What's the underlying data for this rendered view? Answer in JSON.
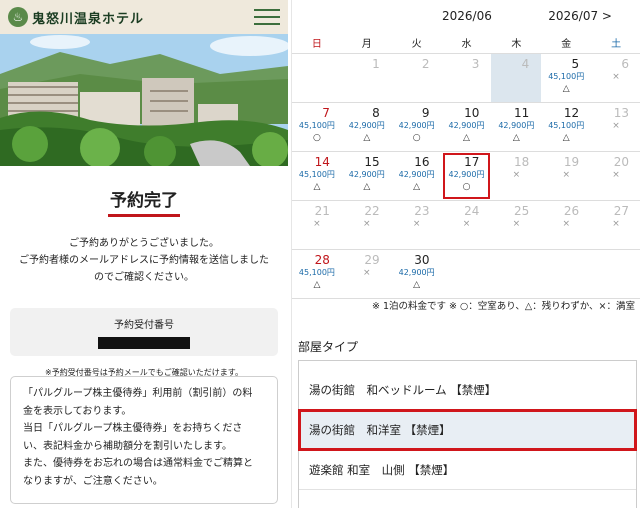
{
  "brand": {
    "name": "鬼怒川温泉ホテル"
  },
  "confirmation": {
    "title": "予約完了",
    "line1": "ご予約ありがとうございました。",
    "line2": "ご予約者様のメールアドレスに予約情報を送信しました",
    "line3": "のでご確認ください。",
    "receipt_label": "予約受付番号",
    "receipt_note": "※予約受付番号は予約メールでもご確認いただけます。"
  },
  "info": {
    "lines": [
      "「パルグループ株主優待券」利用前（割引前）の料",
      "金を表示しております。",
      "当日「パルグループ株主優待券」をお持ちくださ",
      "い、表記料金から補助額分を割引いたします。",
      "また、優待券をお忘れの場合は通常料金でご精算と",
      "なりますが、ご注意ください。"
    ]
  },
  "calendar": {
    "current_month": "2026/06",
    "next_month": "2026/07 >",
    "weekdays": [
      "日",
      "月",
      "火",
      "水",
      "木",
      "金",
      "土"
    ],
    "weeks": [
      [
        {
          "day": "",
          "price": "",
          "mark": "",
          "state": "empty"
        },
        {
          "day": "1",
          "price": "",
          "mark": "",
          "state": "past"
        },
        {
          "day": "2",
          "price": "",
          "mark": "",
          "state": "past"
        },
        {
          "day": "3",
          "price": "",
          "mark": "",
          "state": "past"
        },
        {
          "day": "4",
          "price": "",
          "mark": "",
          "state": "today"
        },
        {
          "day": "5",
          "price": "45,100円",
          "mark": "△",
          "state": "avail"
        },
        {
          "day": "6",
          "price": "",
          "mark": "×",
          "state": "na"
        }
      ],
      [
        {
          "day": "7",
          "price": "45,100円",
          "mark": "○",
          "state": "avail"
        },
        {
          "day": "8",
          "price": "42,900円",
          "mark": "△",
          "state": "avail"
        },
        {
          "day": "9",
          "price": "42,900円",
          "mark": "○",
          "state": "avail"
        },
        {
          "day": "10",
          "price": "42,900円",
          "mark": "△",
          "state": "avail"
        },
        {
          "day": "11",
          "price": "42,900円",
          "mark": "△",
          "state": "avail"
        },
        {
          "day": "12",
          "price": "45,100円",
          "mark": "△",
          "state": "avail"
        },
        {
          "day": "13",
          "price": "",
          "mark": "×",
          "state": "na"
        }
      ],
      [
        {
          "day": "14",
          "price": "45,100円",
          "mark": "△",
          "state": "avail"
        },
        {
          "day": "15",
          "price": "42,900円",
          "mark": "△",
          "state": "avail"
        },
        {
          "day": "16",
          "price": "42,900円",
          "mark": "△",
          "state": "avail"
        },
        {
          "day": "17",
          "price": "42,900円",
          "mark": "○",
          "state": "selected"
        },
        {
          "day": "18",
          "price": "",
          "mark": "×",
          "state": "na"
        },
        {
          "day": "19",
          "price": "",
          "mark": "×",
          "state": "na"
        },
        {
          "day": "20",
          "price": "",
          "mark": "×",
          "state": "na"
        }
      ],
      [
        {
          "day": "21",
          "price": "",
          "mark": "×",
          "state": "na"
        },
        {
          "day": "22",
          "price": "",
          "mark": "×",
          "state": "na"
        },
        {
          "day": "23",
          "price": "",
          "mark": "×",
          "state": "na"
        },
        {
          "day": "24",
          "price": "",
          "mark": "×",
          "state": "na"
        },
        {
          "day": "25",
          "price": "",
          "mark": "×",
          "state": "na"
        },
        {
          "day": "26",
          "price": "",
          "mark": "×",
          "state": "na"
        },
        {
          "day": "27",
          "price": "",
          "mark": "×",
          "state": "na"
        }
      ],
      [
        {
          "day": "28",
          "price": "45,100円",
          "mark": "△",
          "state": "avail"
        },
        {
          "day": "29",
          "price": "",
          "mark": "×",
          "state": "na"
        },
        {
          "day": "30",
          "price": "42,900円",
          "mark": "△",
          "state": "avail"
        },
        {
          "day": "",
          "price": "",
          "mark": "",
          "state": "empty"
        },
        {
          "day": "",
          "price": "",
          "mark": "",
          "state": "empty"
        },
        {
          "day": "",
          "price": "",
          "mark": "",
          "state": "empty"
        },
        {
          "day": "",
          "price": "",
          "mark": "",
          "state": "empty"
        }
      ]
    ],
    "legend": "※ 1泊の料金です ※ ○：空室あり、△：残りわずか、×：満室"
  },
  "room_types": {
    "title": "部屋タイプ",
    "items": [
      {
        "label": "湯の街館　和ベッドルーム 【禁煙】",
        "selected": false
      },
      {
        "label": "湯の街館　和洋室 【禁煙】",
        "selected": true
      },
      {
        "label": "遊楽館 和室　山側 【禁煙】",
        "selected": false
      }
    ]
  },
  "colors": {
    "accent": "#d0161b",
    "price": "#1b6aa8",
    "header_bg": "#efe9dc"
  }
}
